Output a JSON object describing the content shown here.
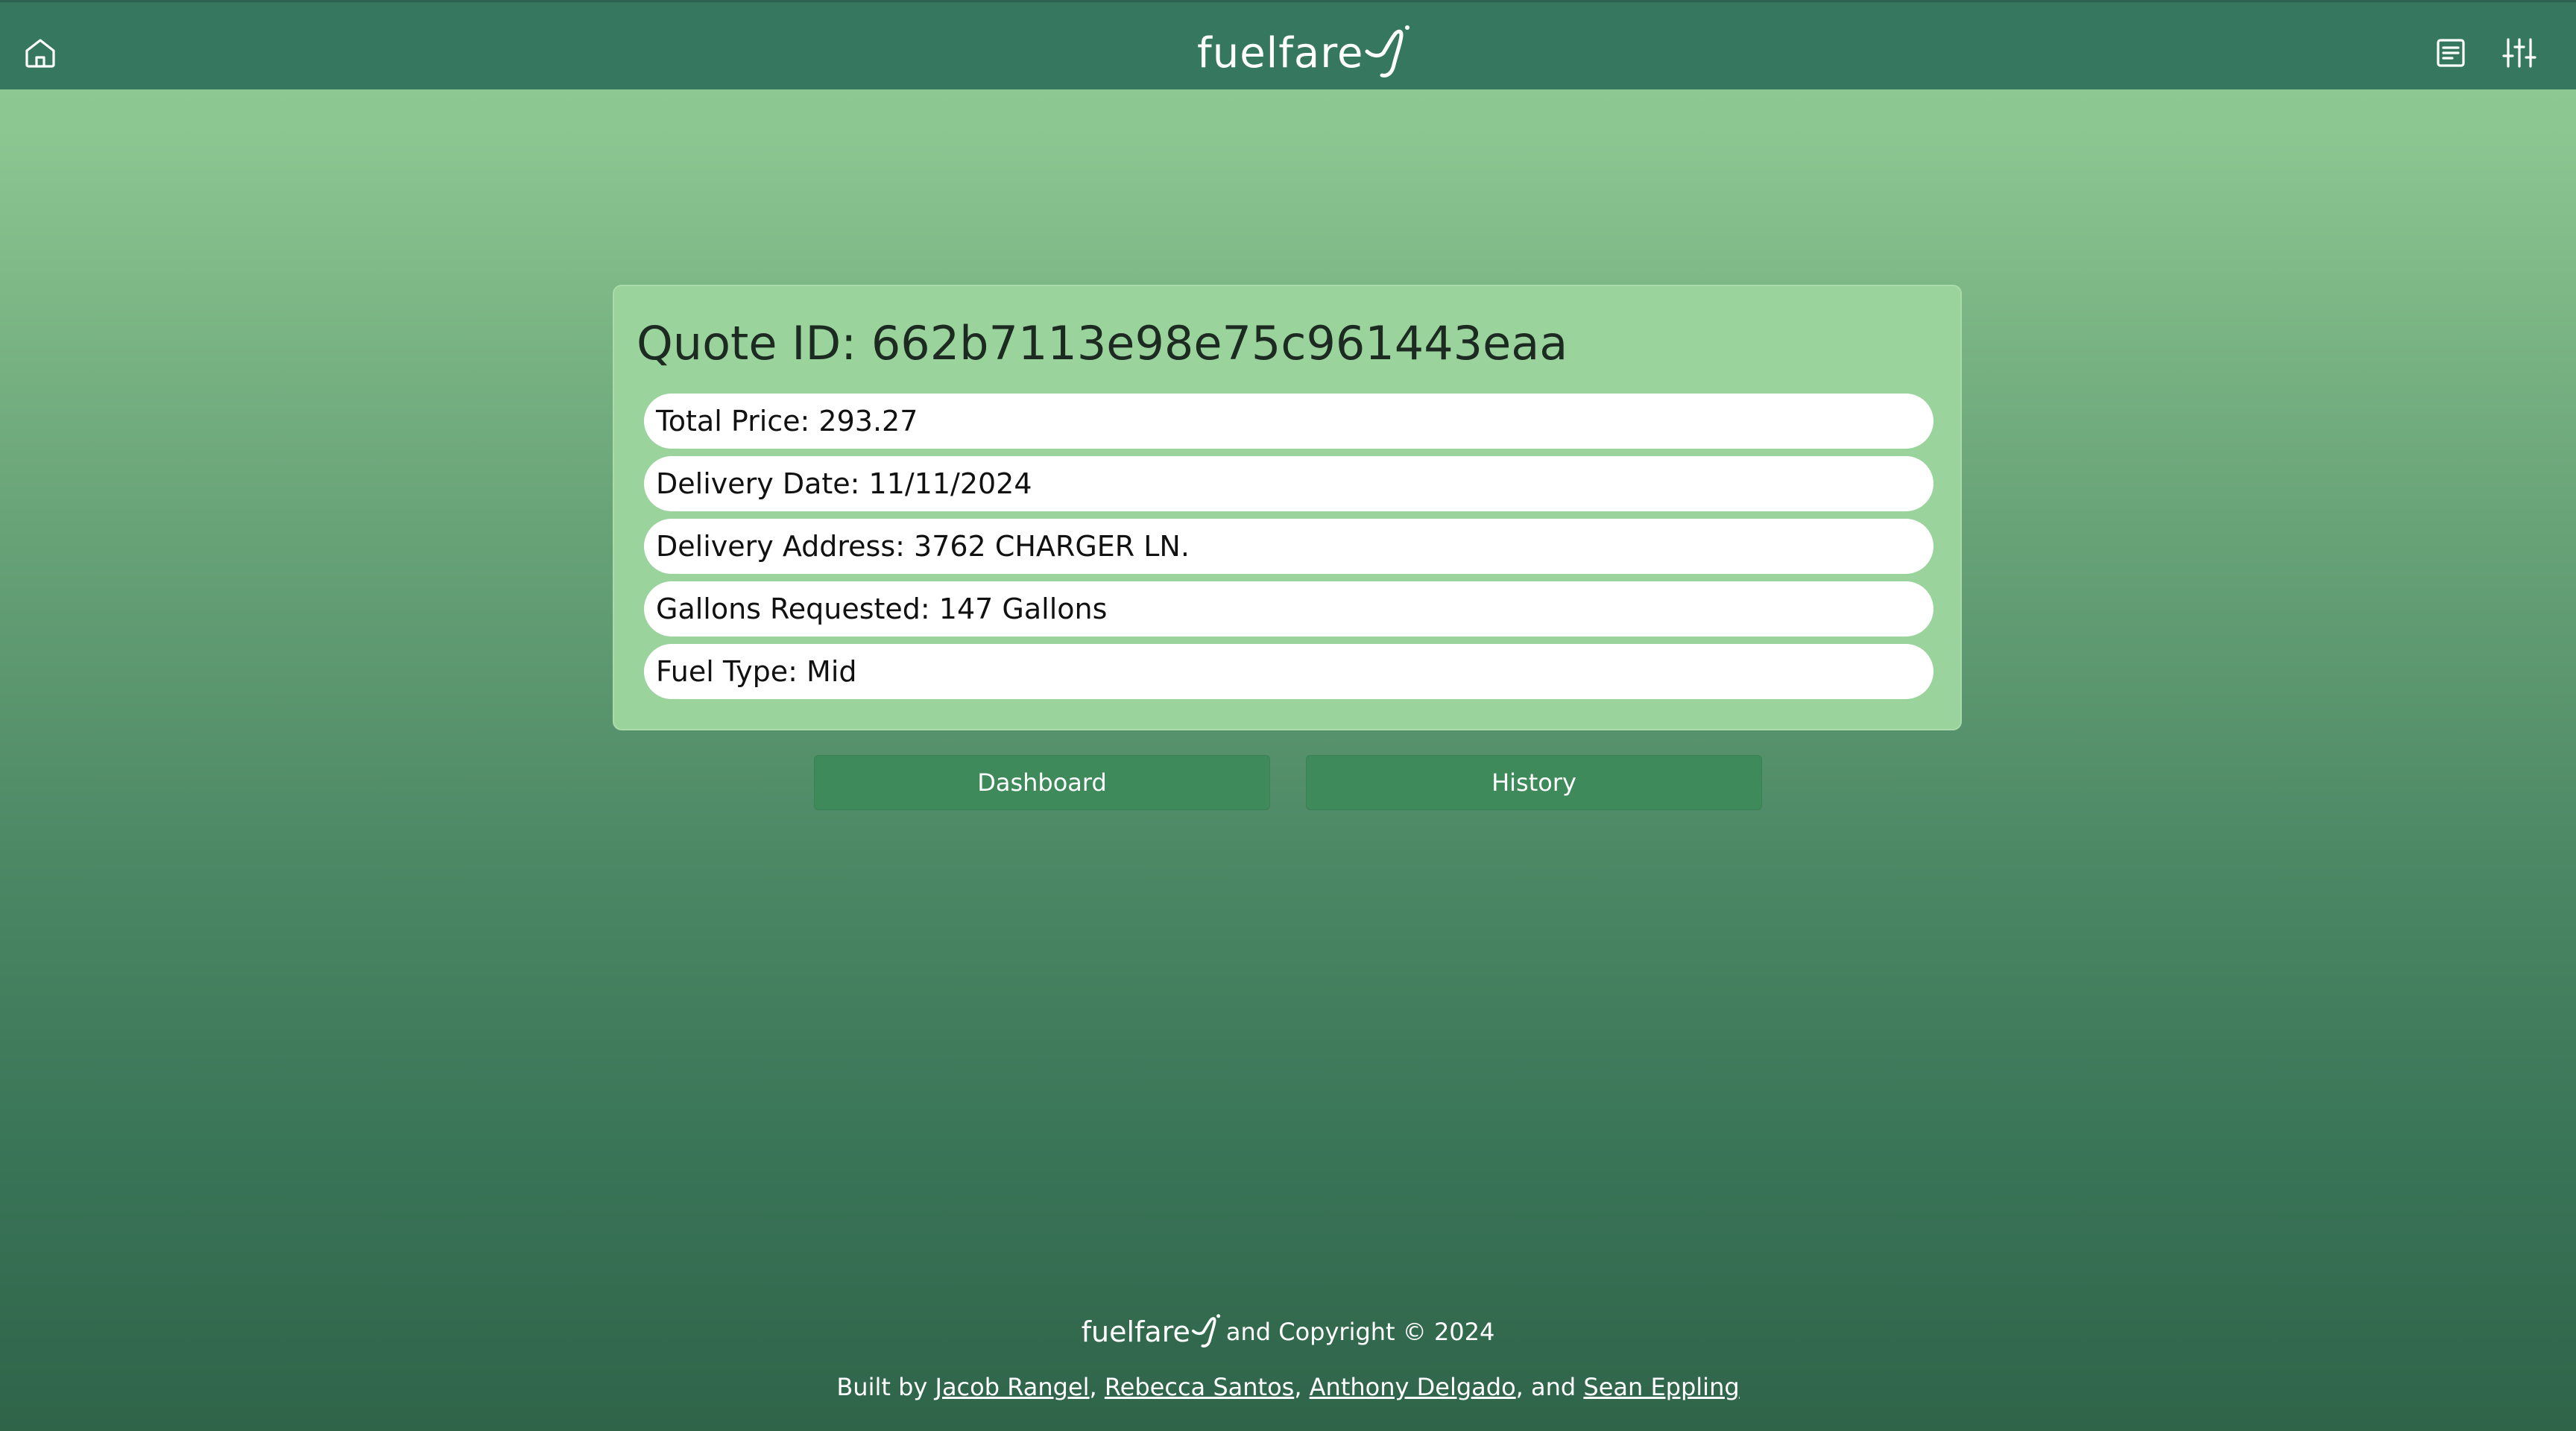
{
  "header": {
    "logo_text": "fuelfare",
    "icons": [
      "home-icon",
      "list-icon",
      "sliders-icon"
    ]
  },
  "quote": {
    "title": "Quote ID: 662b7113e98e75c961443eaa",
    "fields": [
      "Total Price: 293.27",
      "Delivery Date: 11/11/2024",
      "Delivery Address: 3762 CHARGER LN.",
      "Gallons Requested: 147 Gallons",
      "Fuel Type: Mid"
    ]
  },
  "buttons": {
    "dashboard": "Dashboard",
    "history": "History"
  },
  "footer": {
    "logo_text": "fuelfare",
    "copyright": "and Copyright © 2024",
    "built_by": "Built by",
    "authors": [
      "Jacob Rangel",
      "Rebecca Santos",
      "Anthony Delgado",
      "Sean Eppling"
    ],
    "sep1": ",",
    "sep2": ",",
    "sep3": ", and"
  },
  "colors": {
    "header_bg": "#36785f",
    "card_bg": "#9ad49c",
    "button_bg": "#3e8a5a",
    "gradient_top": "#90cc94",
    "gradient_bottom": "#2f6449"
  }
}
